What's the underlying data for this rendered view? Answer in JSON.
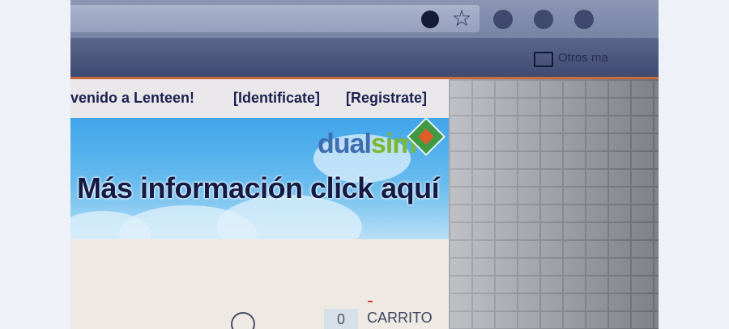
{
  "browser": {
    "bookmarks": {
      "other_label": "Otros ma"
    },
    "icons": [
      "extension-icon",
      "star-icon",
      "folder-icon"
    ]
  },
  "page": {
    "welcome": {
      "greeting": "venido a Lenteen!",
      "login_link": "[Identificate]",
      "register_link": "[Registrate]"
    },
    "banner": {
      "brand_part1": "dual",
      "brand_part2": "sim",
      "promo_text": "Más información click aquí"
    },
    "cart": {
      "count": "0",
      "label": "CARRITO"
    }
  },
  "colors": {
    "accent_border": "#c76a3e",
    "welcome_text": "#1b2150",
    "brand_blue": "#3f6db1",
    "brand_green": "#7cb82f"
  }
}
